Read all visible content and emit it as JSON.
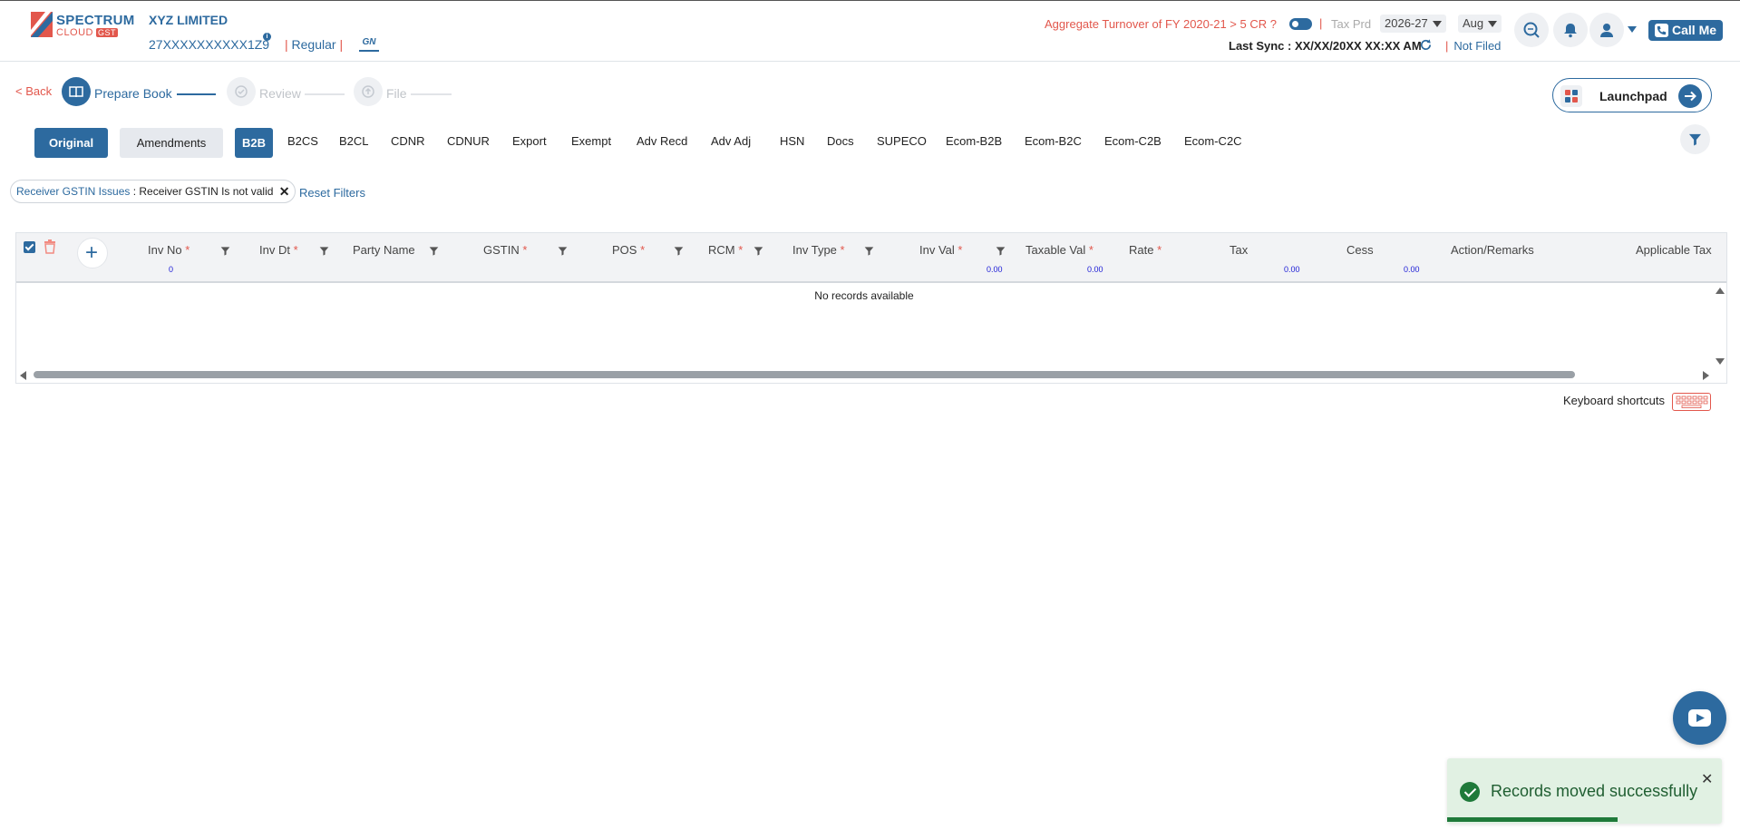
{
  "header": {
    "logo": {
      "line1": "SPECTRUM",
      "line2": "CLOUD",
      "badge": "GST"
    },
    "company_name": "XYZ LIMITED",
    "gstin": "27XXXXXXXXXX1Z9",
    "registration_type": "Regular",
    "turnover_text": "Aggregate Turnover of FY 2020-21 > 5 CR ?",
    "tax_period_label": "Tax Prd",
    "fiscal_year": "2026-27",
    "month": "Aug",
    "last_sync": "Last Sync : XX/XX/20XX XX:XX AM",
    "filing_status": "Not Filed",
    "call_me_label": "Call Me",
    "accent_color": "#2d6a9f",
    "alert_color": "#e2574c"
  },
  "stepper": {
    "back_label": "< Back",
    "steps": [
      {
        "label": "Prepare Book",
        "state": "active"
      },
      {
        "label": "Review",
        "state": "inactive"
      },
      {
        "label": "File",
        "state": "inactive"
      }
    ],
    "launchpad_label": "Launchpad"
  },
  "tabs": {
    "mode": [
      {
        "label": "Original",
        "active": true
      },
      {
        "label": "Amendments",
        "active": false
      }
    ],
    "sections": [
      "B2B",
      "B2CS",
      "B2CL",
      "CDNR",
      "CDNUR",
      "Export",
      "Exempt",
      "Adv Recd",
      "Adv Adj",
      "HSN",
      "Docs",
      "SUPECO",
      "Ecom-B2B",
      "Ecom-B2C",
      "Ecom-C2B",
      "Ecom-C2C"
    ],
    "active_section": "B2B"
  },
  "filters": {
    "chip_key": "Receiver GSTIN Issues",
    "chip_value": " : Receiver GSTIN Is not valid",
    "reset_label": "Reset Filters"
  },
  "grid": {
    "columns": [
      {
        "label": "Inv No",
        "required": true,
        "filter": true
      },
      {
        "label": "Inv Dt",
        "required": true,
        "filter": true
      },
      {
        "label": "Party Name",
        "required": false,
        "filter": true
      },
      {
        "label": "GSTIN",
        "required": true,
        "filter": true
      },
      {
        "label": "POS",
        "required": true,
        "filter": true
      },
      {
        "label": "RCM",
        "required": true,
        "filter": true
      },
      {
        "label": "Inv Type",
        "required": true,
        "filter": true
      },
      {
        "label": "Inv Val",
        "required": true,
        "filter": true
      },
      {
        "label": "Taxable Val",
        "required": true,
        "filter": false
      },
      {
        "label": "Rate",
        "required": true,
        "filter": false
      },
      {
        "label": "Tax",
        "required": false,
        "filter": false
      },
      {
        "label": "Cess",
        "required": false,
        "filter": false
      },
      {
        "label": "Action/Remarks",
        "required": false,
        "filter": false
      },
      {
        "label": "Applicable Tax",
        "required": false,
        "filter": false
      }
    ],
    "totals": {
      "inv_count": "0",
      "inv_val": "0.00",
      "taxable_val": "0.00",
      "tax": "0.00",
      "cess": "0.00"
    },
    "empty_message": "No records available",
    "required_marker": "*"
  },
  "footer": {
    "keyboard_shortcuts_label": "Keyboard shortcuts"
  },
  "toast": {
    "message": "Records moved successfully",
    "close": "✕",
    "progress": 0.62
  }
}
